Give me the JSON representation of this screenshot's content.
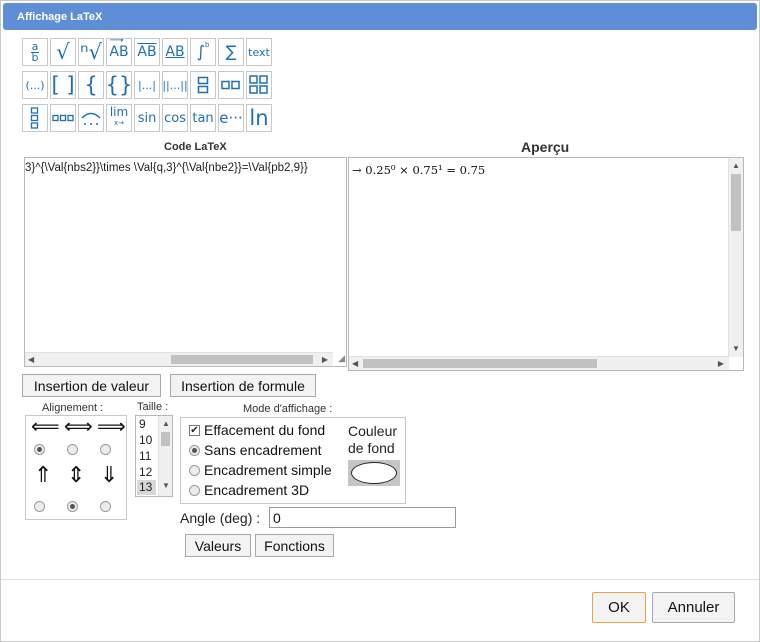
{
  "window": {
    "title": "Affichage LaTeX"
  },
  "palette": {
    "row1": [
      "a/b",
      "√",
      "ⁿ√",
      "AB→",
      "AB‾",
      "AB_",
      "∫ab",
      "Σ",
      "text"
    ],
    "row2": [
      "(...)",
      "[ ]",
      "{",
      "{}",
      "|...|",
      "||...||",
      "col2",
      "row2",
      "grid4"
    ],
    "row3": [
      "col3",
      "row3",
      "arc",
      "lim",
      "sin",
      "cos",
      "tan",
      "e···",
      "ln"
    ],
    "labels": {
      "frac_num": "a",
      "frac_den": "b",
      "sqrt": "√",
      "nroot": "ⁿ√",
      "vec": "AB",
      "overline": "AB",
      "underline": "AB",
      "integral": "∫",
      "sum": "∑",
      "text": "text",
      "paren": "(...)",
      "bracket": "[ ]",
      "brace_open": "{",
      "braces": "{}",
      "abs": "|...|",
      "norm": "||...||",
      "lim": "lim",
      "lim_sub": "x→",
      "sin": "sin",
      "cos": "cos",
      "tan": "tan",
      "exp": "e···",
      "ln": "ln"
    }
  },
  "code_label": "Code LaTeX",
  "preview_label": "Aperçu",
  "editor": {
    "content": "3}^{\\Val{nbs2}}\\times \\Val{q,3}^{\\Val{nbe2}}=\\Val{pb2,9}}"
  },
  "preview": {
    "content": "→ 0.25⁰ × 0.75¹ = 0.75"
  },
  "buttons": {
    "insert_value": "Insertion de valeur",
    "insert_formula": "Insertion de formule",
    "values": "Valeurs",
    "functions": "Fonctions",
    "ok": "OK",
    "cancel": "Annuler"
  },
  "alignment": {
    "label": "Alignement :",
    "horizontal_selected": "left",
    "vertical_selected": "center"
  },
  "size": {
    "label": "Taille :",
    "options": [
      "9",
      "10",
      "11",
      "12",
      "13"
    ],
    "selected": "13"
  },
  "display_mode": {
    "label": "Mode d'affichage :",
    "erase_background": {
      "label": "Effacement du fond",
      "checked": true
    },
    "frame_options": [
      "Sans encadrement",
      "Encadrement simple",
      "Encadrement 3D"
    ],
    "frame_selected": "Sans encadrement",
    "bg_color_label_1": "Couleur",
    "bg_color_label_2": "de fond"
  },
  "angle": {
    "label": "Angle (deg) :",
    "value": "0"
  },
  "colors": {
    "titlebar": "#5e8ed6",
    "icon": "#1d6fb3",
    "ok_border": "#e8a33d"
  }
}
